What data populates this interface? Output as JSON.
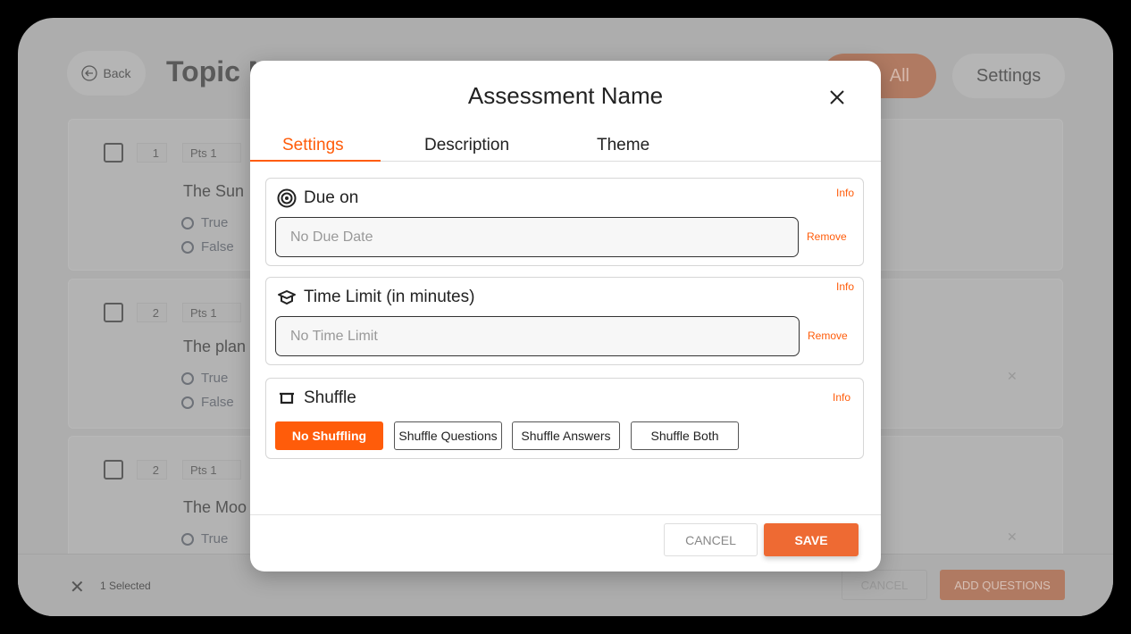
{
  "background": {
    "back_label": "Back",
    "page_title": "Topic M",
    "header_button_partial": "All",
    "settings_label": "Settings",
    "questions": [
      {
        "number": "1",
        "points": "Pts 1",
        "text": "The Sun",
        "options": [
          "True",
          "False"
        ]
      },
      {
        "number": "2",
        "points": "Pts 1",
        "text": "The plan",
        "options": [
          "True",
          "False"
        ]
      },
      {
        "number": "2",
        "points": "Pts 1",
        "text": "The Moo",
        "options": [
          "True"
        ]
      }
    ],
    "bottom_bar": {
      "selected_count": "1 Selected",
      "cancel_label": "CANCEL",
      "add_questions_label": "ADD QUESTIONS"
    }
  },
  "modal": {
    "title": "Assessment Name",
    "tabs": [
      {
        "label": "Settings",
        "active": true
      },
      {
        "label": "Description",
        "active": false
      },
      {
        "label": "Theme",
        "active": false
      }
    ],
    "due_on": {
      "label": "Due on",
      "info": "Info",
      "placeholder": "No Due Date",
      "remove": "Remove",
      "icon": "target-icon"
    },
    "time_limit": {
      "label": "Time Limit (in minutes)",
      "info": "Info",
      "placeholder": "No Time Limit",
      "remove": "Remove",
      "icon": "graduation-cap-icon"
    },
    "shuffle": {
      "label": "Shuffle",
      "info": "Info",
      "icon": "tray-icon",
      "options": [
        {
          "label": "No Shuffling",
          "selected": true
        },
        {
          "label": "Shuffle Questions",
          "selected": false
        },
        {
          "label": "Shuffle Answers",
          "selected": false
        },
        {
          "label": "Shuffle Both",
          "selected": false
        }
      ]
    },
    "cancel_label": "CANCEL",
    "save_label": "SAVE"
  },
  "colors": {
    "accent": "#ff5c0a",
    "save": "#ee6a33",
    "overlay_gray": "#adadad"
  }
}
